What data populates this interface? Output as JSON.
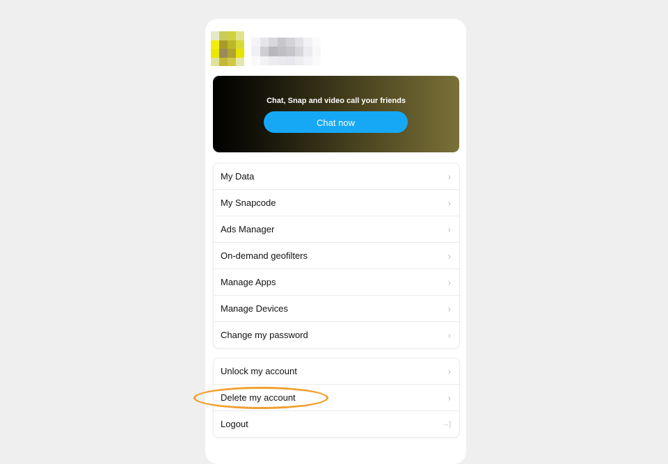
{
  "profile": {
    "avatar_pixels": [
      "#e6e9c8",
      "#c9cc5a",
      "#cfd23f",
      "#e0e38a",
      "#f2ee10",
      "#a89c28",
      "#bcb82a",
      "#d9d938",
      "#eae800",
      "#9a8a58",
      "#b0a430",
      "#e8e400",
      "#dfe39a",
      "#c4b838",
      "#cfc844",
      "#e4e6b0"
    ],
    "username_pixels": [
      "#f4f4f6",
      "#e6e6ea",
      "#d8d8dc",
      "#c8c8cc",
      "#d4d4d8",
      "#e2e2e6",
      "#f2f2f4",
      "#fafafa",
      "#f0f0f2",
      "#cfcfd3",
      "#b8b8bc",
      "#c0c0c4",
      "#c6c6ca",
      "#d6d6da",
      "#ececef",
      "#f8f8f8",
      "#fafafa",
      "#f2f2f4",
      "#ececef",
      "#eaeaee",
      "#e8e8ec",
      "#ededf0",
      "#f4f4f6",
      "#fbfbfb"
    ]
  },
  "banner": {
    "text": "Chat, Snap and video call your friends",
    "button_label": "Chat now",
    "button_color": "#17a8f5"
  },
  "menu_group_1": [
    {
      "label": "My Data",
      "icon": "chevron-right-icon"
    },
    {
      "label": "My Snapcode",
      "icon": "chevron-right-icon"
    },
    {
      "label": "Ads Manager",
      "icon": "chevron-right-icon"
    },
    {
      "label": "On-demand geofilters",
      "icon": "chevron-right-icon"
    },
    {
      "label": "Manage Apps",
      "icon": "chevron-right-icon"
    },
    {
      "label": "Manage Devices",
      "icon": "chevron-right-icon"
    },
    {
      "label": "Change my password",
      "icon": "chevron-right-icon"
    }
  ],
  "menu_group_2": [
    {
      "label": "Unlock my account",
      "icon": "chevron-right-icon"
    },
    {
      "label": "Delete my account",
      "icon": "chevron-right-icon",
      "highlighted": true
    },
    {
      "label": "Logout",
      "icon": "logout-icon"
    }
  ],
  "glyphs": {
    "chevron": "›",
    "logout": "→]"
  },
  "annotation_color": "#f0a030"
}
